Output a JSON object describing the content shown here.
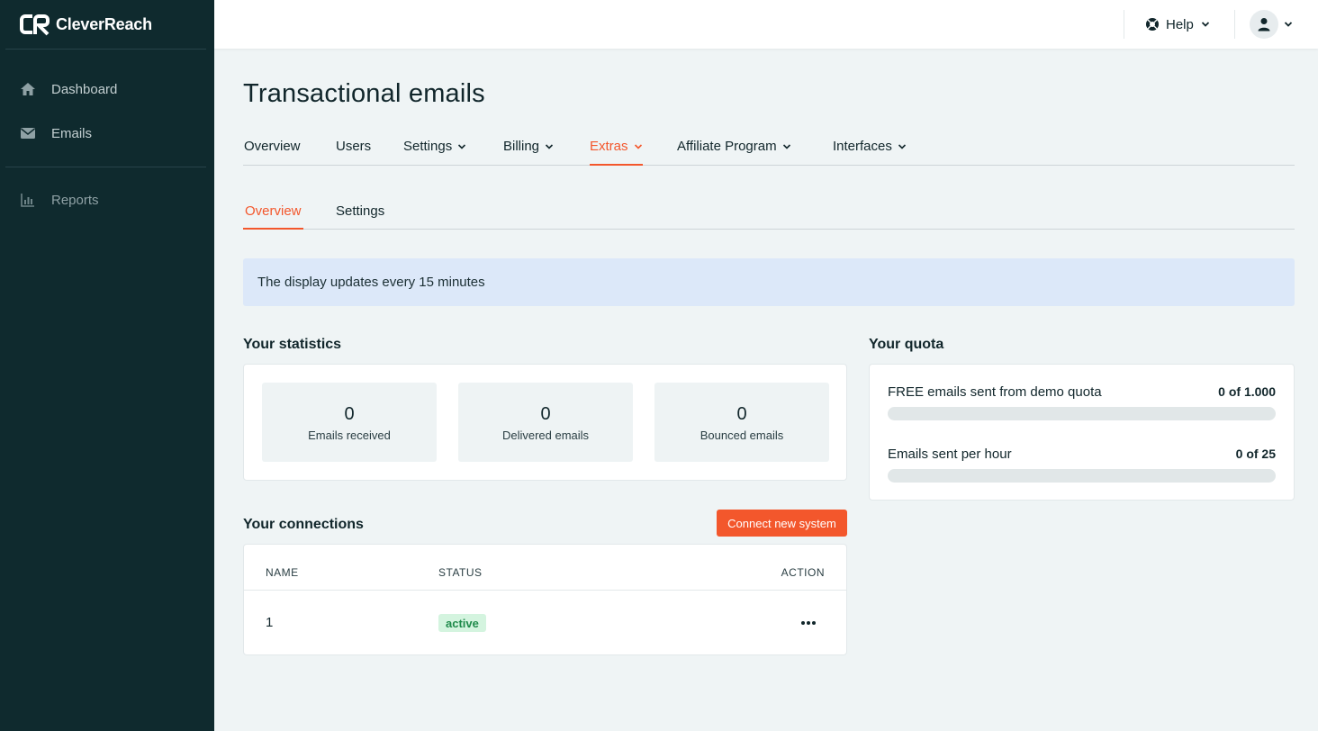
{
  "brand": {
    "name": "CleverReach",
    "accent": "#f3572c",
    "sidebar_bg": "#0f2a2e"
  },
  "sidebar": {
    "items": [
      {
        "label": "Dashboard",
        "icon": "home-icon"
      },
      {
        "label": "Emails",
        "icon": "envelope-icon"
      },
      {
        "label": "Reports",
        "icon": "bar-chart-icon"
      }
    ]
  },
  "topbar": {
    "help_label": "Help"
  },
  "page": {
    "title": "Transactional emails"
  },
  "tabs": [
    {
      "label": "Overview",
      "dropdown": false
    },
    {
      "label": "Users",
      "dropdown": false
    },
    {
      "label": "Settings",
      "dropdown": true
    },
    {
      "label": "Billing",
      "dropdown": true
    },
    {
      "label": "Extras",
      "dropdown": true,
      "active": true
    },
    {
      "label": "Affiliate Program",
      "dropdown": true
    },
    {
      "label": "Interfaces",
      "dropdown": true
    }
  ],
  "subtabs": [
    {
      "label": "Overview",
      "active": true
    },
    {
      "label": "Settings"
    }
  ],
  "info_banner": "The display updates every 15 minutes",
  "statistics": {
    "title": "Your statistics",
    "items": [
      {
        "value": "0",
        "label": "Emails received"
      },
      {
        "value": "0",
        "label": "Delivered emails"
      },
      {
        "value": "0",
        "label": "Bounced emails"
      }
    ]
  },
  "quota": {
    "title": "Your quota",
    "rows": [
      {
        "label": "FREE emails sent from demo quota",
        "value": "0 of 1.000",
        "fraction": 0
      },
      {
        "label": "Emails sent per hour",
        "value": "0 of 25",
        "fraction": 0
      }
    ]
  },
  "connections": {
    "title": "Your connections",
    "connect_label": "Connect new system",
    "columns": {
      "name": "NAME",
      "status": "STATUS",
      "action": "ACTION"
    },
    "rows": [
      {
        "name": "1",
        "status": "active"
      }
    ]
  }
}
